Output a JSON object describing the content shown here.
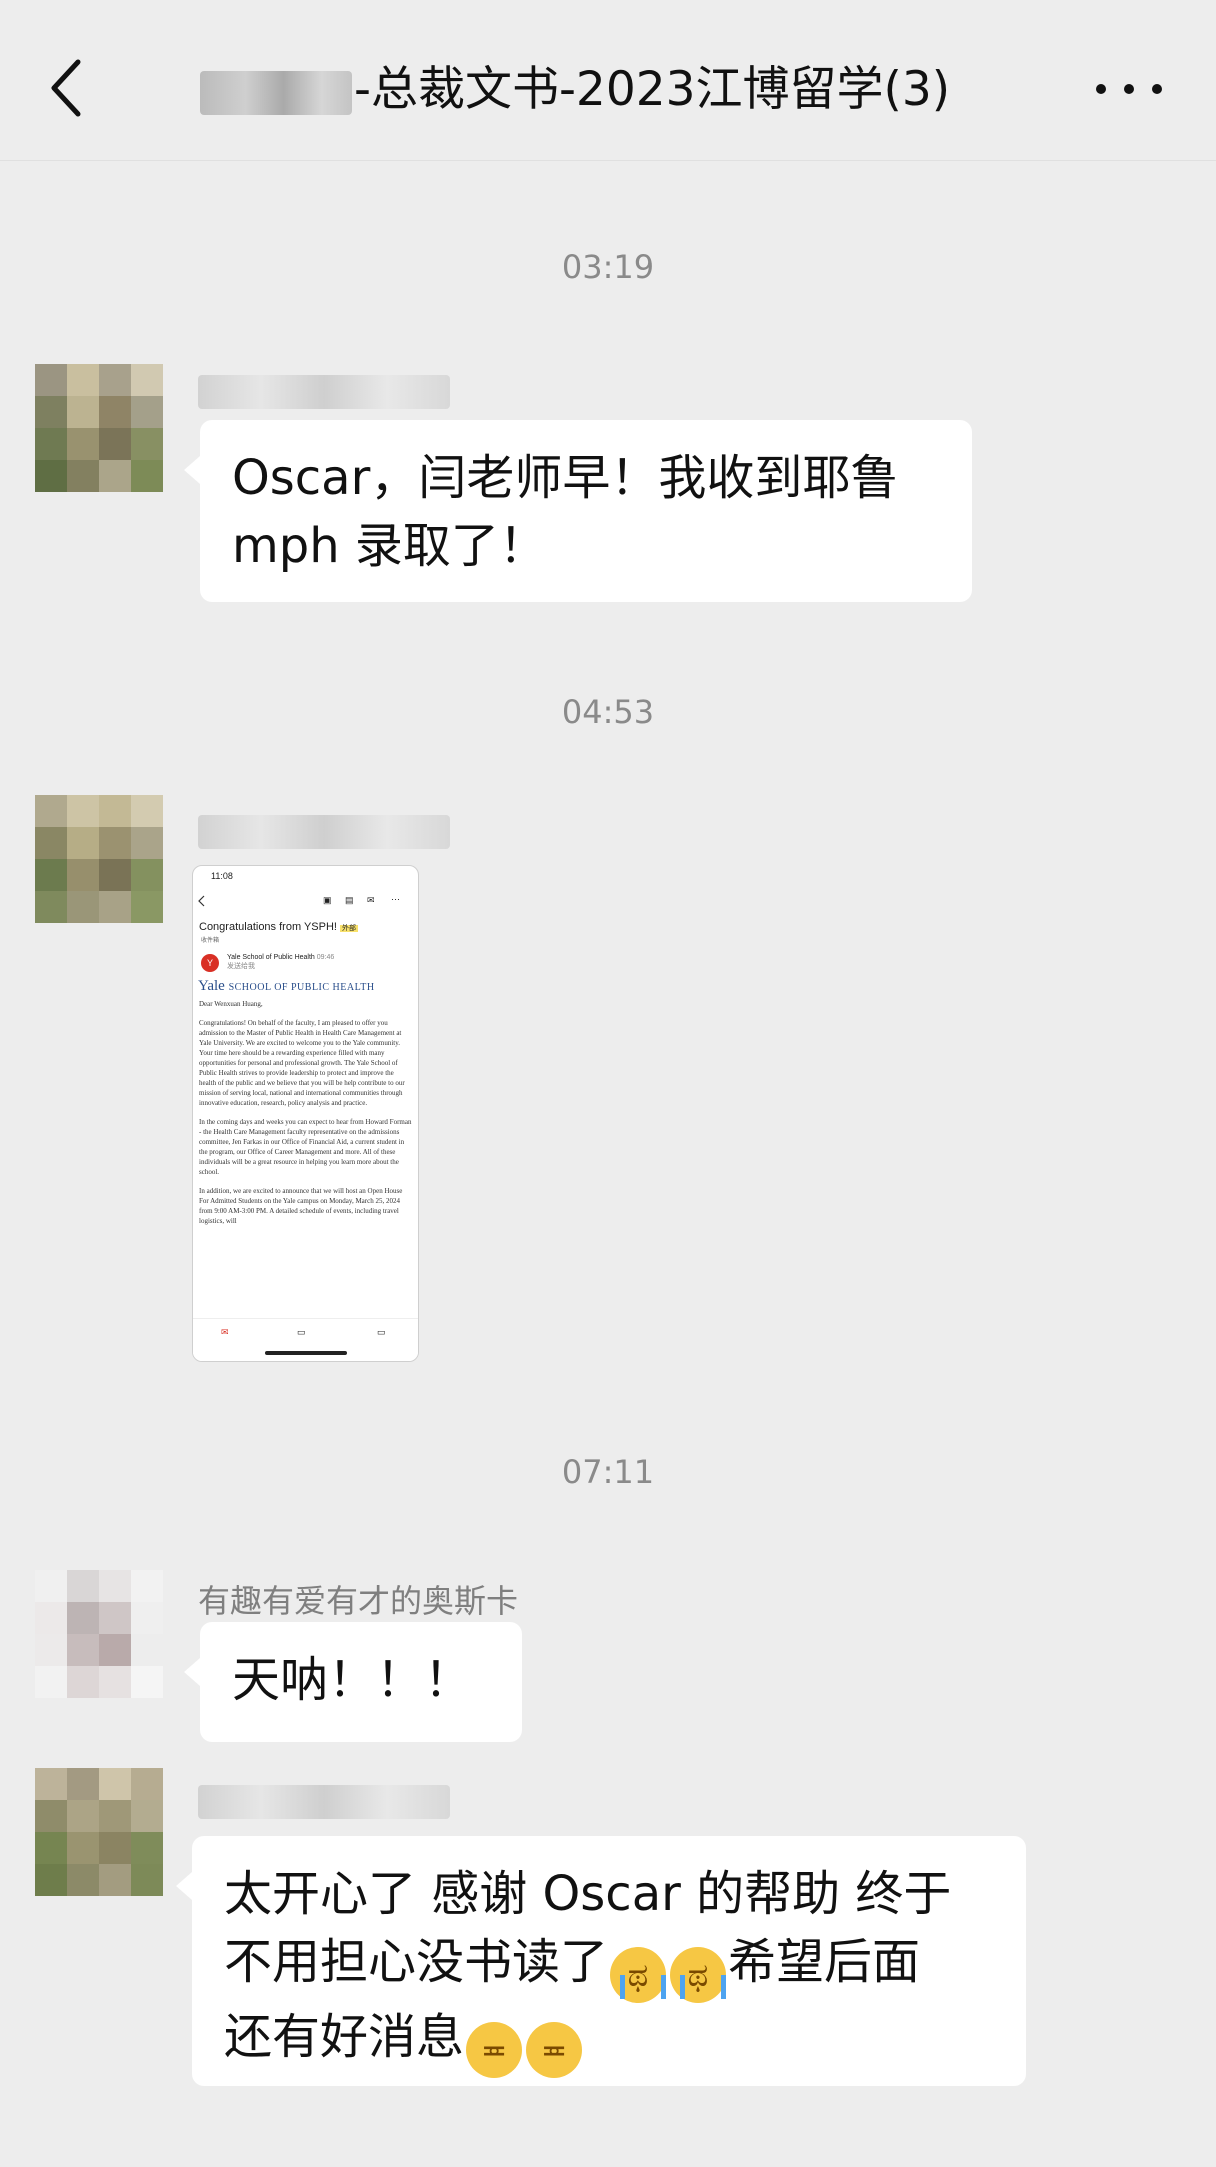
{
  "header": {
    "title": "-总裁文书-2023江博留学(3)"
  },
  "messages": {
    "m1_time": "03:19",
    "m1_text_line1": "Oscar，闫老师早！我收到耶鲁",
    "m1_text_line2": "mph 录取了！",
    "m2_time": "04:53",
    "m3_time": "07:11",
    "m3_sender": "有趣有爱有才的奥斯卡",
    "m3_text": "天呐！！！",
    "m4_text_line1": "太开心了 感谢 Oscar 的帮助 终于",
    "m4_text_line2": "不用担心没书读了",
    "m4_text_line2b": "希望后面",
    "m4_text_line3": "还有好消息"
  },
  "screenshot": {
    "status_time": "11:08",
    "subject": "Congratulations from YSPH!",
    "subject_tag": "外部",
    "inbox_label": "收件箱",
    "sender": "Yale School of Public Health",
    "sender_time": "09:46",
    "recipient_label": "发送给我",
    "yale_logo": "Yale",
    "yale_school": "SCHOOL OF PUBLIC HEALTH",
    "greeting": "Dear   Wenxuan Huang,",
    "para1": "Congratulations! On behalf of the faculty, I am pleased to offer you admission to the Master of Public Health in Health Care Management at Yale University. We are excited to welcome you to the Yale community. Your time here should be a rewarding experience filled with many opportunities for personal and professional growth. The Yale School of Public Health strives to provide leadership to protect and improve the health of the public and we believe that you will be help contribute to our mission of serving local, national and international communities through innovative education, research, policy analysis and practice.",
    "para2": "In the coming days and weeks you can expect to hear from Howard Forman - the Health Care Management faculty representative on the admissions committee, Jen Farkas in our Office of Financial Aid, a current student in the program, our Office of Career Management and more. All of these individuals will be a great resource in helping you learn more about the school.",
    "para3": "In addition, we are excited to announce that we will host an Open House For Admitted Students on the Yale campus on Monday, March 25, 2024 from 9:00 AM-3:00 PM.  A detailed schedule of events, including travel logistics, will"
  }
}
